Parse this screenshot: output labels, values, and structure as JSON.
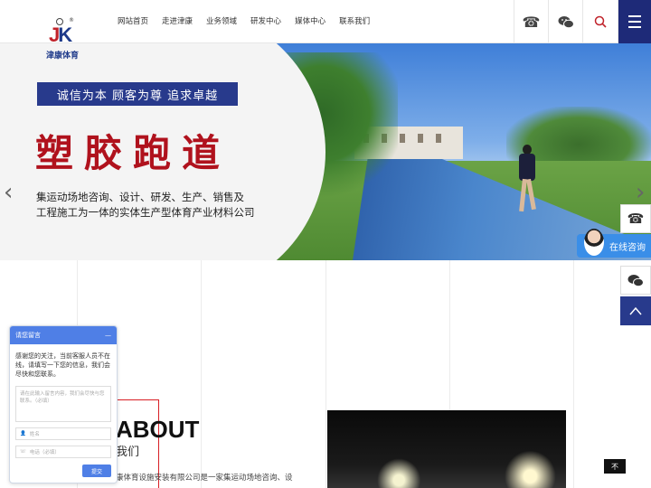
{
  "logo": {
    "brand_text": "津康体育",
    "mark": "JK"
  },
  "nav": {
    "items": [
      {
        "label": "网站首页"
      },
      {
        "label": "走进津康"
      },
      {
        "label": "业务领域"
      },
      {
        "label": "研发中心"
      },
      {
        "label": "媒体中心"
      },
      {
        "label": "联系我们"
      }
    ]
  },
  "header_icons": [
    "phone-icon",
    "wechat-icon",
    "search-icon",
    "menu-icon"
  ],
  "banner": {
    "slogan": "诚信为本  顾客为尊  追求卓越",
    "title": "塑胶跑道",
    "desc_line1": "集运动场地咨询、设计、研发、生产、销售及",
    "desc_line2": "工程施工为一体的实体生产型体育产业材料公司",
    "prev": "‹",
    "next": "›"
  },
  "float": {
    "online_label": "在线咨询"
  },
  "about": {
    "heading": "ABOUT",
    "heading_cn": "我们",
    "text": "康体育设施安装有限公司是一家集运动场地咨询、设"
  },
  "chat": {
    "title": "请您留言",
    "minimize": "—",
    "intro": "感谢您的关注，当前客服人员不在线，请填写一下您的信息，我们会尽快和您联系。",
    "message_placeholder": "请在此输入留言内容，我们会尽快与您联系。（必填）",
    "name_placeholder": "姓名",
    "phone_placeholder": "电话（必填）",
    "send_label": "提交"
  },
  "top_button": "不",
  "colors": {
    "brand_blue": "#283a8c",
    "brand_red": "#b0121d",
    "chat_blue": "#4f7fe6"
  }
}
